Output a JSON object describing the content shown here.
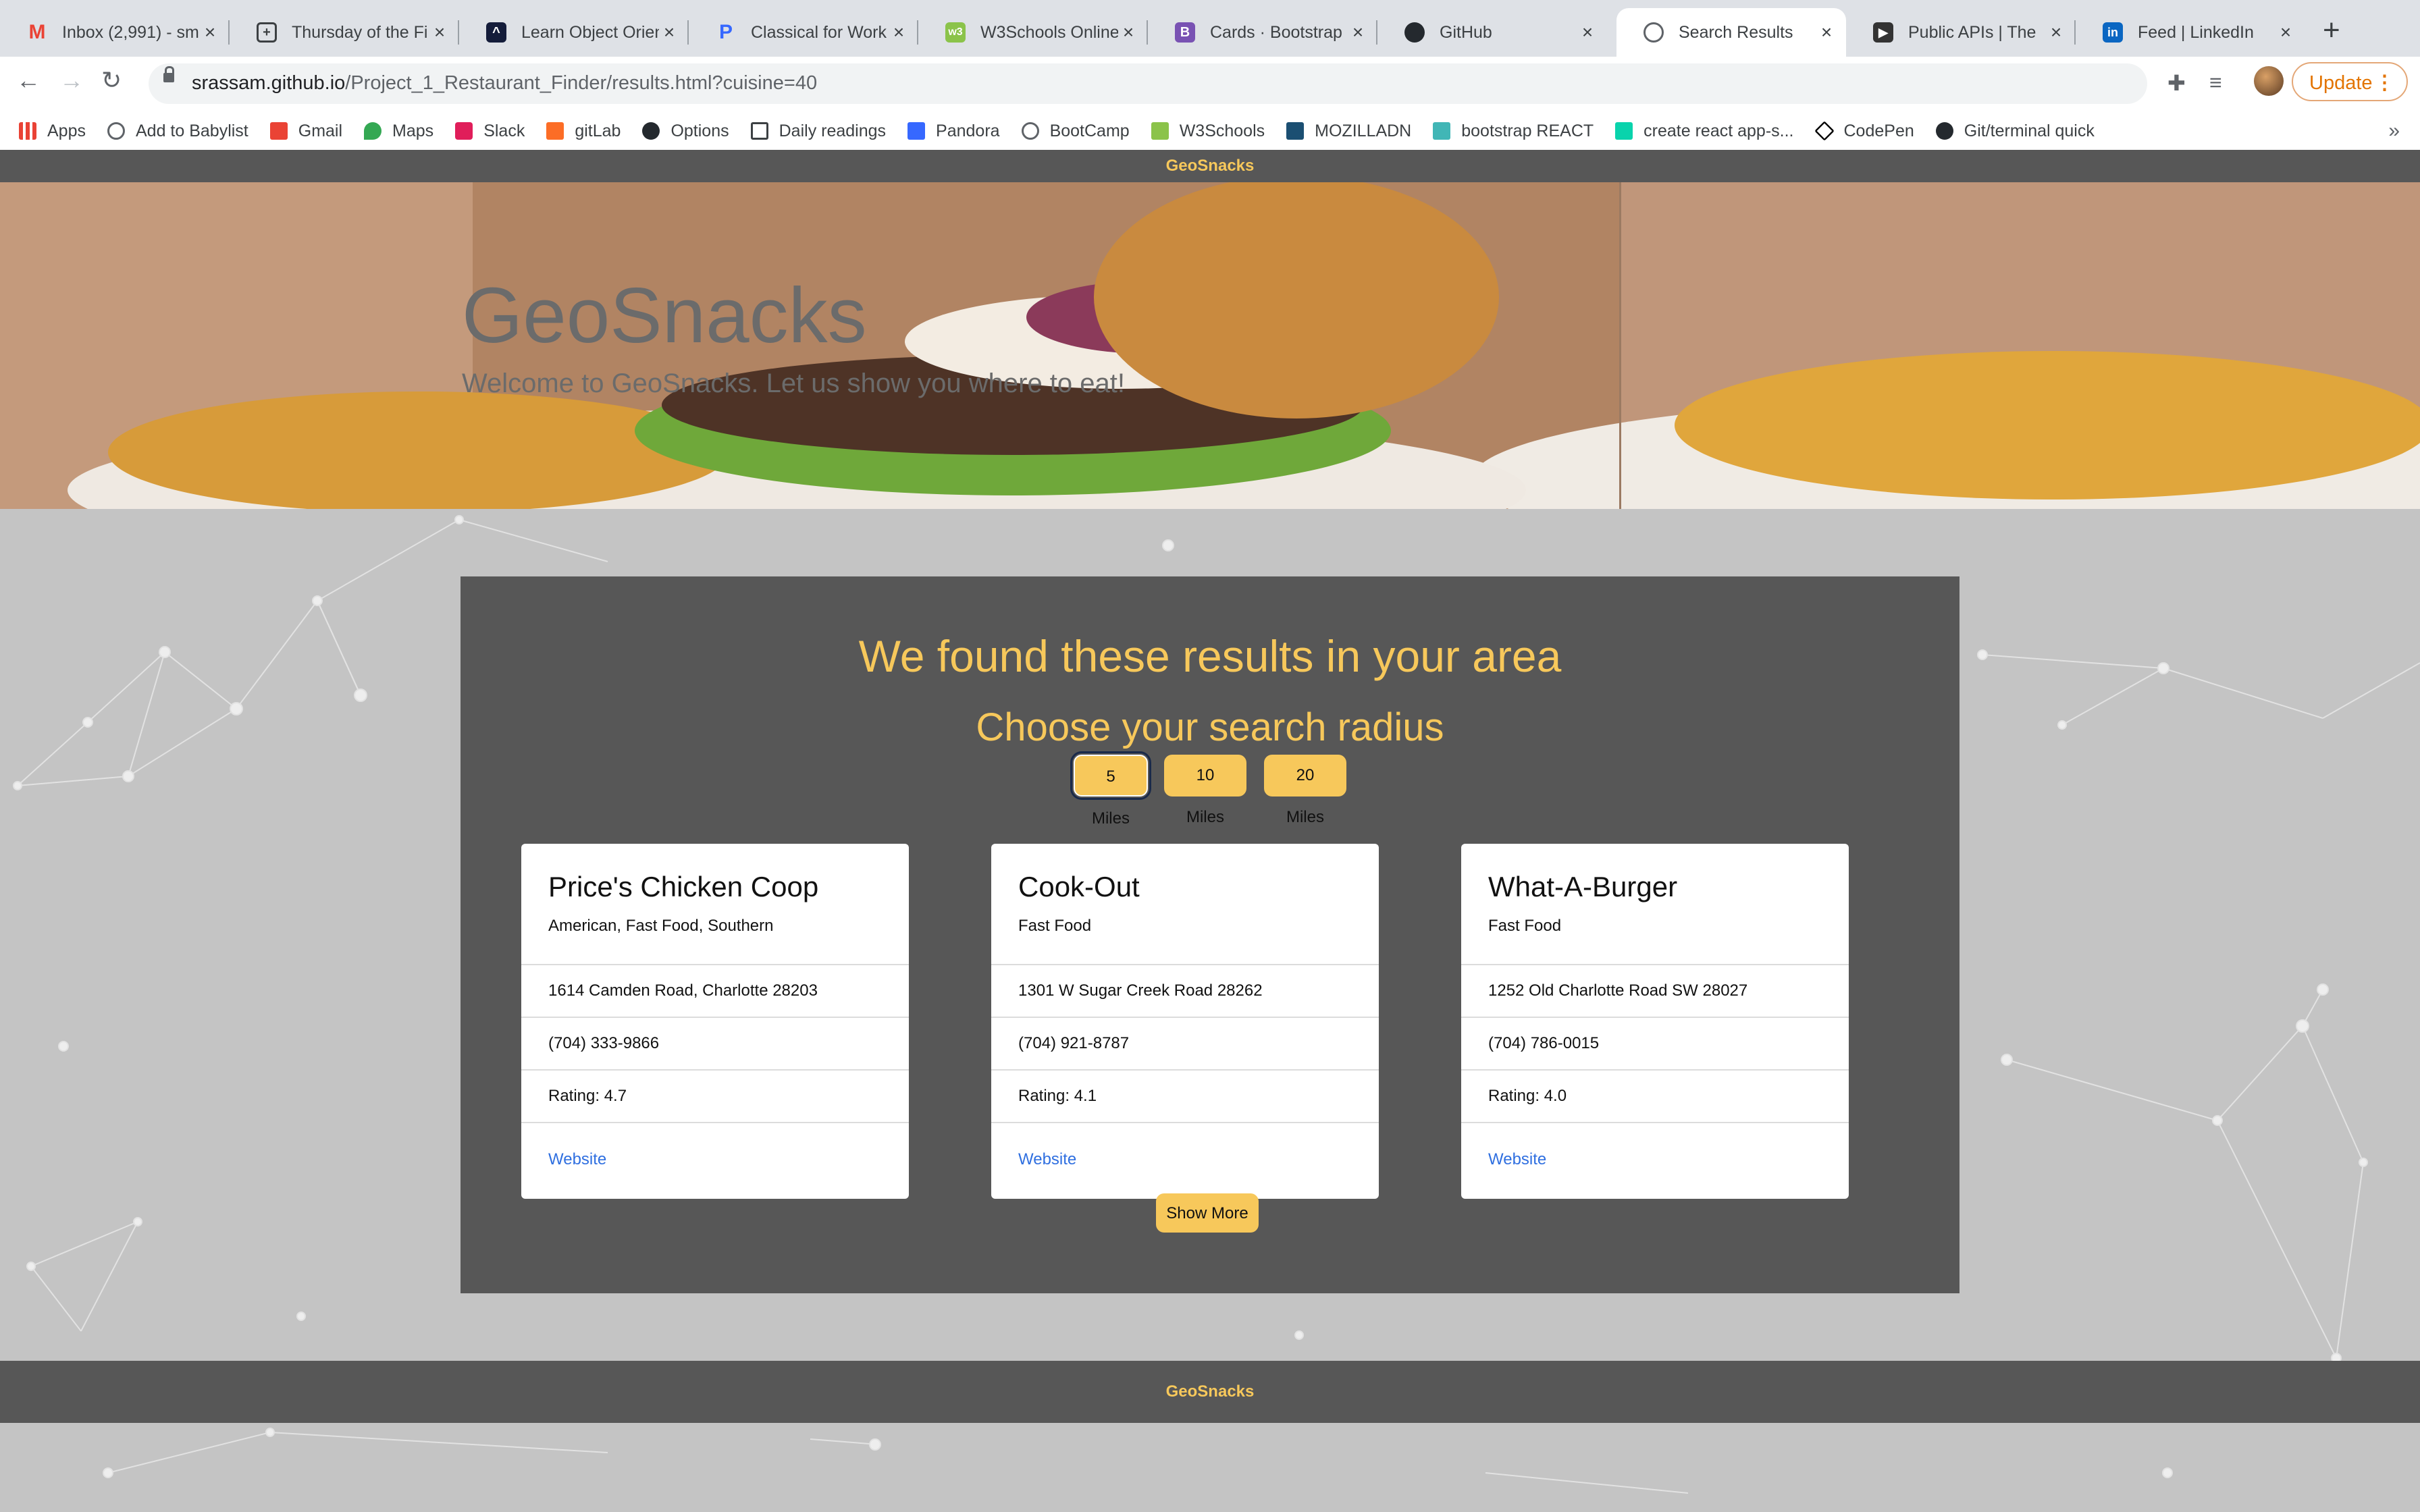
{
  "browser": {
    "tabs": [
      {
        "title": "Inbox (2,991) - sm",
        "icon": "gmail-icon",
        "color": "#ea4335"
      },
      {
        "title": "Thursday of the Fi",
        "icon": "grid-cross-icon",
        "color": "#3c4043"
      },
      {
        "title": "Learn Object Orien",
        "icon": "codecademy-icon",
        "color": "#141c3a"
      },
      {
        "title": "Classical for Work",
        "icon": "pandora-icon",
        "color": "#3668ff"
      },
      {
        "title": "W3Schools Online",
        "icon": "w3schools-icon",
        "color": "#8bc34a"
      },
      {
        "title": "Cards · Bootstrap",
        "icon": "bootstrap-icon",
        "color": "#7952b3"
      },
      {
        "title": "GitHub",
        "icon": "github-icon",
        "color": "#24292e"
      },
      {
        "title": "Search Results",
        "icon": "globe-icon",
        "color": "#5f6368",
        "active": true
      },
      {
        "title": "Public APIs | The",
        "icon": "public-apis-icon",
        "color": "#333333"
      },
      {
        "title": "Feed | LinkedIn",
        "icon": "linkedin-icon",
        "color": "#0a66c2"
      }
    ],
    "url_host": "srassam.github.io",
    "url_path": "/Project_1_Restaurant_Finder/results.html?cuisine=40",
    "update_label": "Update",
    "bookmarks": [
      {
        "label": "Apps",
        "icon": "apps-grid-icon",
        "color": "#e94235"
      },
      {
        "label": "Add to Babylist",
        "icon": "globe-icon",
        "color": "#5f6368"
      },
      {
        "label": "Gmail",
        "icon": "gmail-icon",
        "color": "#ea4335"
      },
      {
        "label": "Maps",
        "icon": "maps-pin-icon",
        "color": "#34a853"
      },
      {
        "label": "Slack",
        "icon": "slack-icon",
        "color": "#e01e5a"
      },
      {
        "label": "gitLab",
        "icon": "gitlab-icon",
        "color": "#fc6d26"
      },
      {
        "label": "Options",
        "icon": "github-icon",
        "color": "#24292e"
      },
      {
        "label": "Daily readings",
        "icon": "grid-cross-icon",
        "color": "#3c4043"
      },
      {
        "label": "Pandora",
        "icon": "pandora-icon",
        "color": "#3668ff"
      },
      {
        "label": "BootCamp",
        "icon": "globe-icon",
        "color": "#5f6368"
      },
      {
        "label": "W3Schools",
        "icon": "w3schools-icon",
        "color": "#8bc34a"
      },
      {
        "label": "MOZILLADN",
        "icon": "mdn-icon",
        "color": "#1b4f72"
      },
      {
        "label": "bootstrap REACT",
        "icon": "react-bootstrap-icon",
        "color": "#41b6b6"
      },
      {
        "label": "create react app-s...",
        "icon": "cra-icon",
        "color": "#09d3ac"
      },
      {
        "label": "CodePen",
        "icon": "codepen-icon",
        "color": "#000000"
      },
      {
        "label": "Git/terminal quick",
        "icon": "github-icon",
        "color": "#24292e"
      }
    ]
  },
  "site": {
    "brand": "GeoSnacks",
    "hero_title": "GeoSnacks",
    "hero_subtitle": "Welcome to GeoSnacks. Let us show you where to eat!",
    "results_heading": "We found these results in your area",
    "radius_heading": "Choose your search radius",
    "radius_options": [
      "5 Miles",
      "10 Miles",
      "20 Miles"
    ],
    "selected_radius": "5 Miles",
    "show_more_label": "Show More",
    "footer_text": "GeoSnacks",
    "accent_color": "#f7c85b",
    "panel_color": "#575757",
    "link_color": "#2f6fe0"
  },
  "restaurants": [
    {
      "name": "Price's Chicken Coop",
      "cuisine": "American, Fast Food, Southern",
      "address": "1614 Camden Road, Charlotte 28203",
      "phone": "(704) 333-9866",
      "rating": "Rating: 4.7",
      "link_label": "Website"
    },
    {
      "name": "Cook-Out",
      "cuisine": "Fast Food",
      "address": "1301 W Sugar Creek Road 28262",
      "phone": "(704) 921-8787",
      "rating": "Rating: 4.1",
      "link_label": "Website"
    },
    {
      "name": "What-A-Burger",
      "cuisine": "Fast Food",
      "address": "1252 Old Charlotte Road SW 28027",
      "phone": "(704) 786-0015",
      "rating": "Rating: 4.0",
      "link_label": "Website"
    }
  ]
}
